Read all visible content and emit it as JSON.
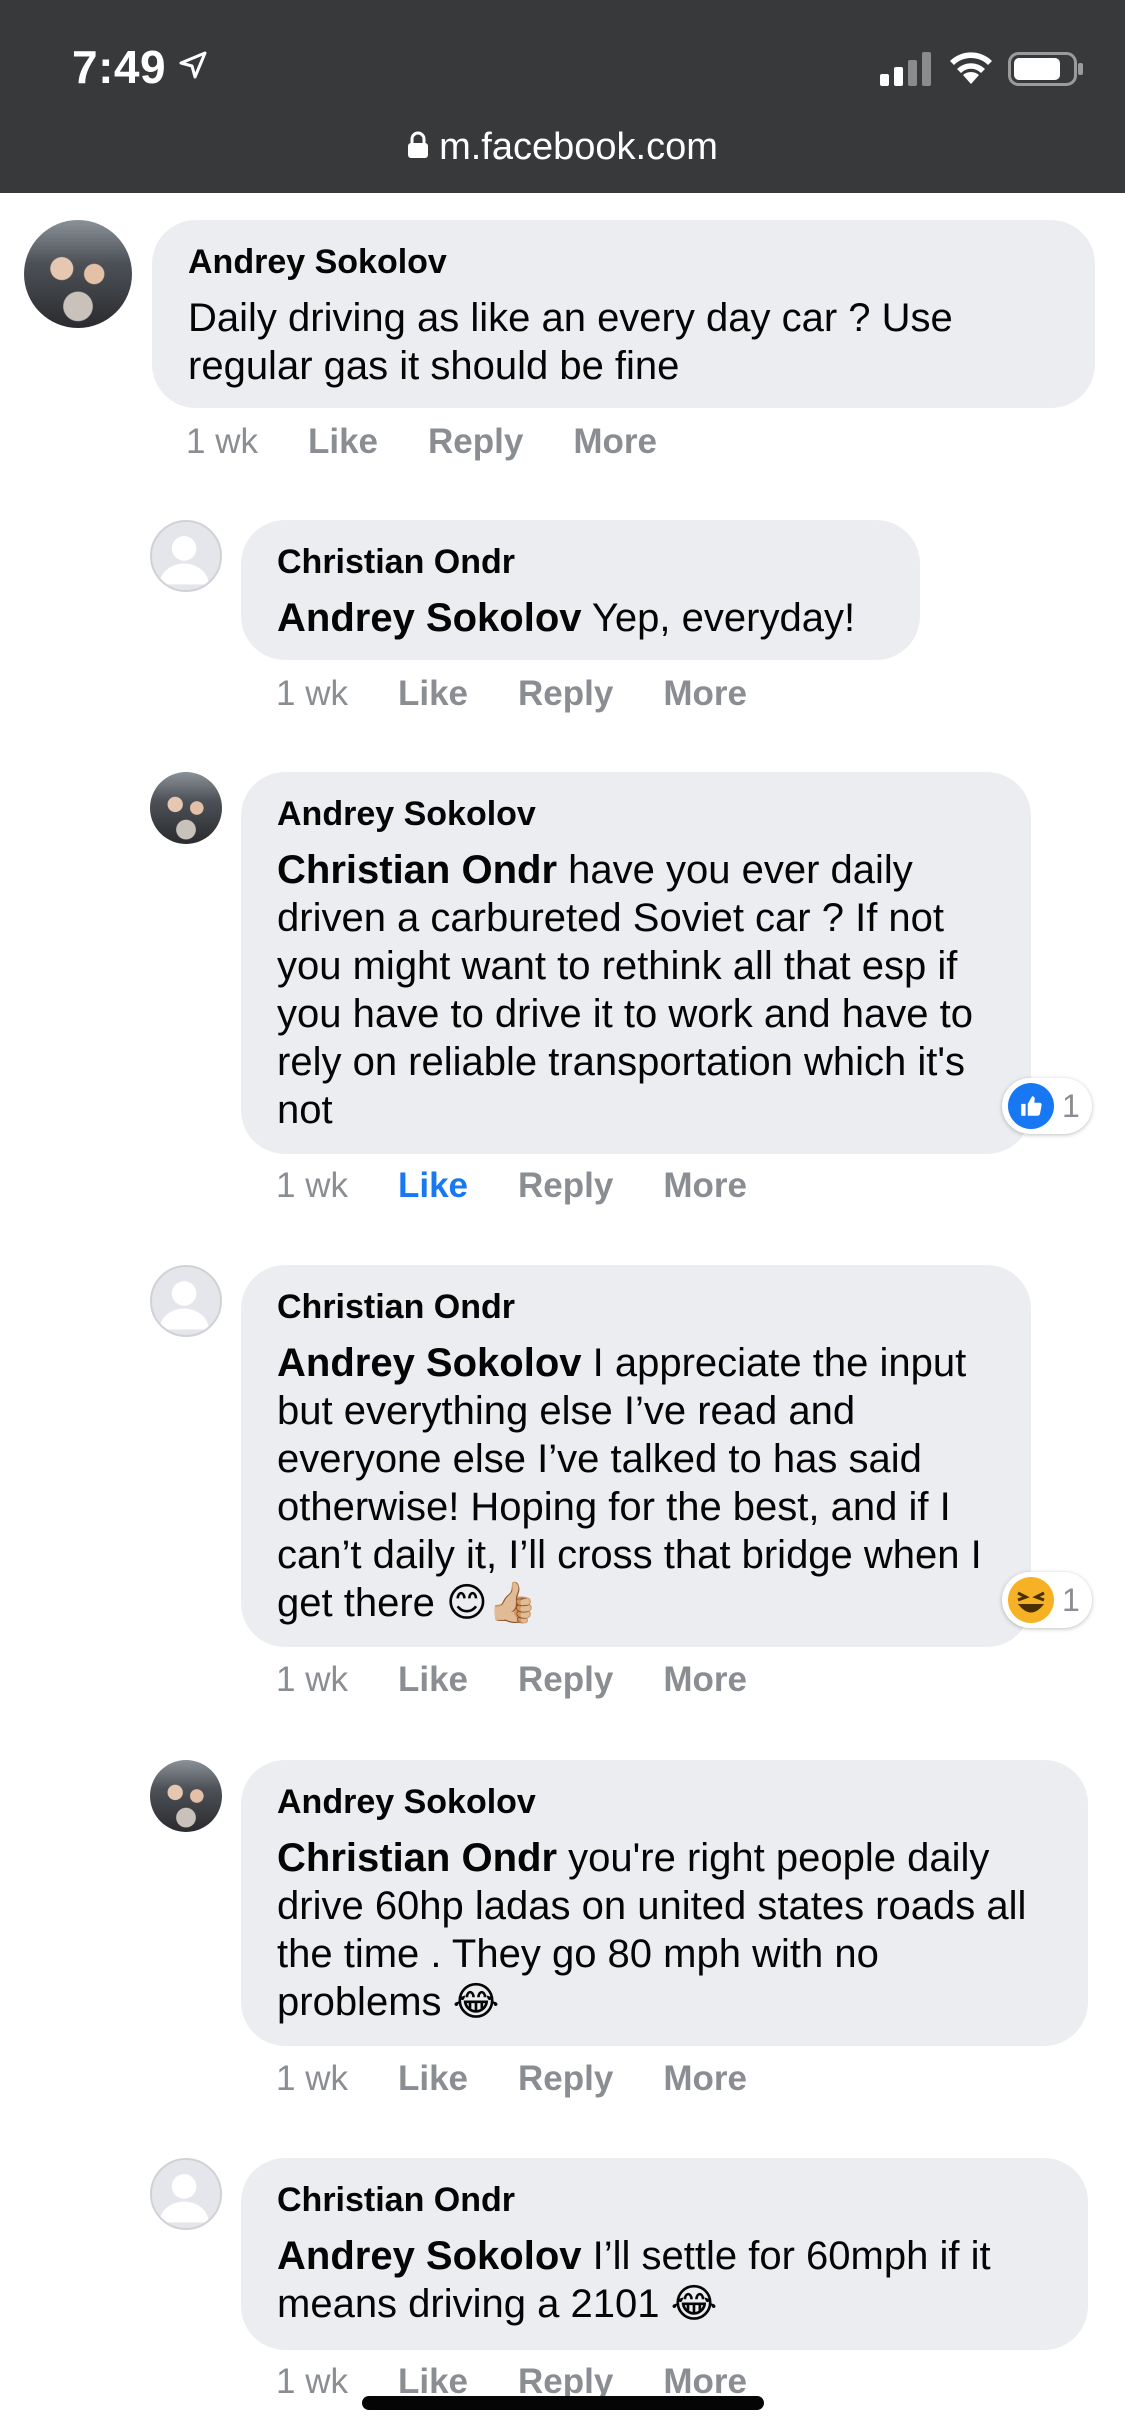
{
  "status_bar": {
    "time": "7:49"
  },
  "url_bar": {
    "domain": "m.facebook.com"
  },
  "comments": [
    {
      "author": "Andrey Sokolov",
      "mention": "",
      "text": "Daily driving as like an every day car ? Use regular gas it should be fine",
      "time": "1 wk",
      "like": "Like",
      "reply": "Reply",
      "more": "More"
    },
    {
      "author": "Christian Ondr",
      "mention": "Andrey Sokolov",
      "text": "Yep, everyday!",
      "time": "1 wk",
      "like": "Like",
      "reply": "Reply",
      "more": "More"
    },
    {
      "author": "Andrey Sokolov",
      "mention": "Christian Ondr",
      "text": "have you ever daily driven a carbureted Soviet car ? If not you might want to rethink all that esp if you have to drive it to work and have to rely on reliable transportation which it's not",
      "time": "1 wk",
      "like": "Like",
      "reply": "Reply",
      "more": "More",
      "reaction": {
        "type": "like-icon",
        "count": "1"
      }
    },
    {
      "author": "Christian Ondr",
      "mention": "Andrey Sokolov",
      "text": "I appreciate the input but everything else I’ve read and everyone else I’ve talked to has said otherwise! Hoping for the best, and if I can’t daily it, I’ll cross that bridge when I get there 😊👍🏼",
      "time": "1 wk",
      "like": "Like",
      "reply": "Reply",
      "more": "More",
      "reaction": {
        "type": "haha-icon",
        "count": "1"
      }
    },
    {
      "author": "Andrey Sokolov",
      "mention": "Christian Ondr",
      "text": "you're right people daily drive 60hp ladas on united states roads all the time . They go 80 mph with no problems 😂",
      "time": "1 wk",
      "like": "Like",
      "reply": "Reply",
      "more": "More"
    },
    {
      "author": "Christian Ondr",
      "mention": "Andrey Sokolov",
      "text": "I’ll settle for 60mph if it means driving a 2101 😂",
      "time": "1 wk",
      "like": "Like",
      "reply": "Reply",
      "more": "More"
    }
  ],
  "colors": {
    "bubble": "#ebedf0",
    "liked": "#1877f2",
    "meta": "#8a8d91"
  }
}
